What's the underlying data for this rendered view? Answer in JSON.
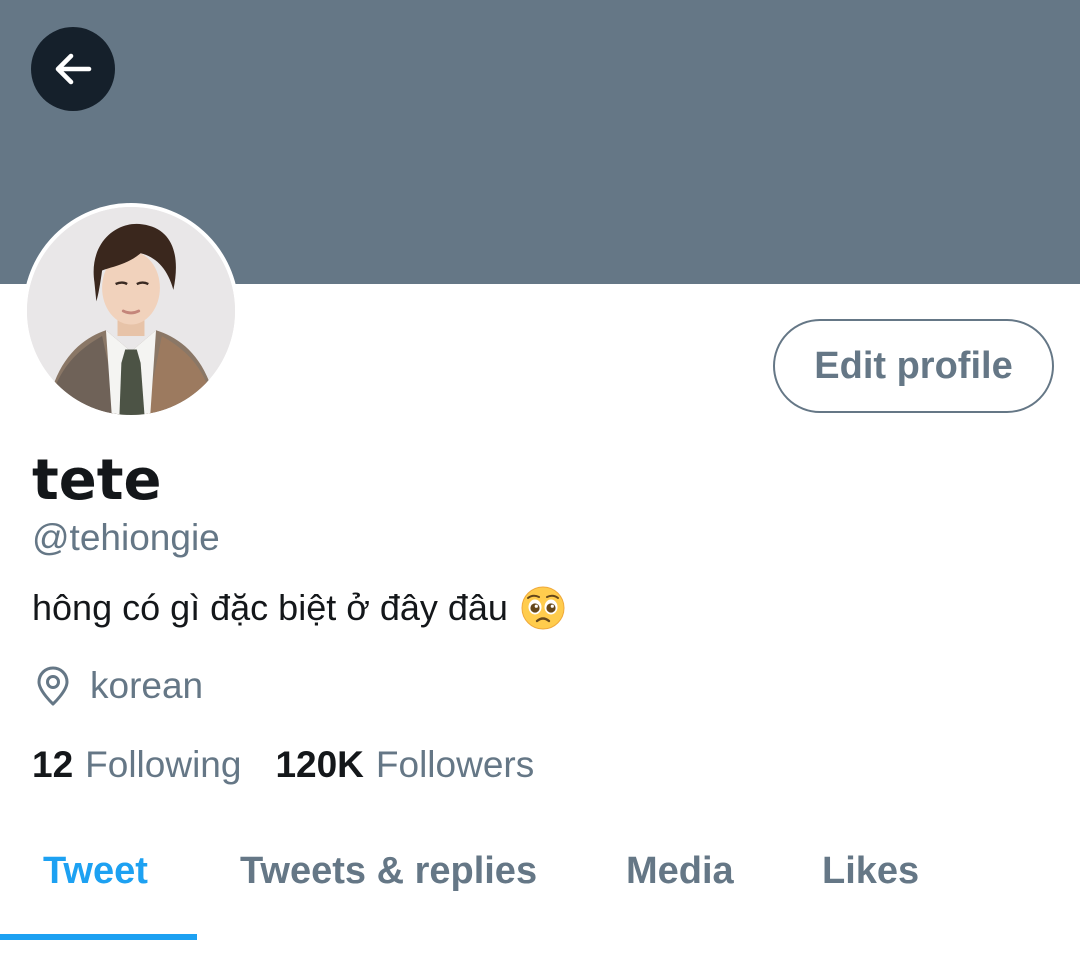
{
  "colors": {
    "banner": "#657786",
    "accent": "#1da1f2",
    "secondary_text": "#657786",
    "primary_text": "#14171a",
    "back_button_bg": "#15202b"
  },
  "header": {
    "back_icon": "arrow-left-icon"
  },
  "profile": {
    "avatar_icon": "profile-photo",
    "edit_button_label": "Edit profile",
    "display_name": "tete",
    "handle": "@tehiongie",
    "bio": "hông có gì đặc biệt ở đây đâu",
    "bio_emoji": "pleading-face-emoji",
    "location_icon": "location-pin-icon",
    "location": "korean"
  },
  "stats": {
    "following_count": "12",
    "following_label": "Following",
    "followers_count": "120K",
    "followers_label": "Followers"
  },
  "tabs": [
    {
      "label": "Tweet",
      "active": true
    },
    {
      "label": "Tweets & replies",
      "active": false
    },
    {
      "label": "Media",
      "active": false
    },
    {
      "label": "Likes",
      "active": false
    }
  ]
}
